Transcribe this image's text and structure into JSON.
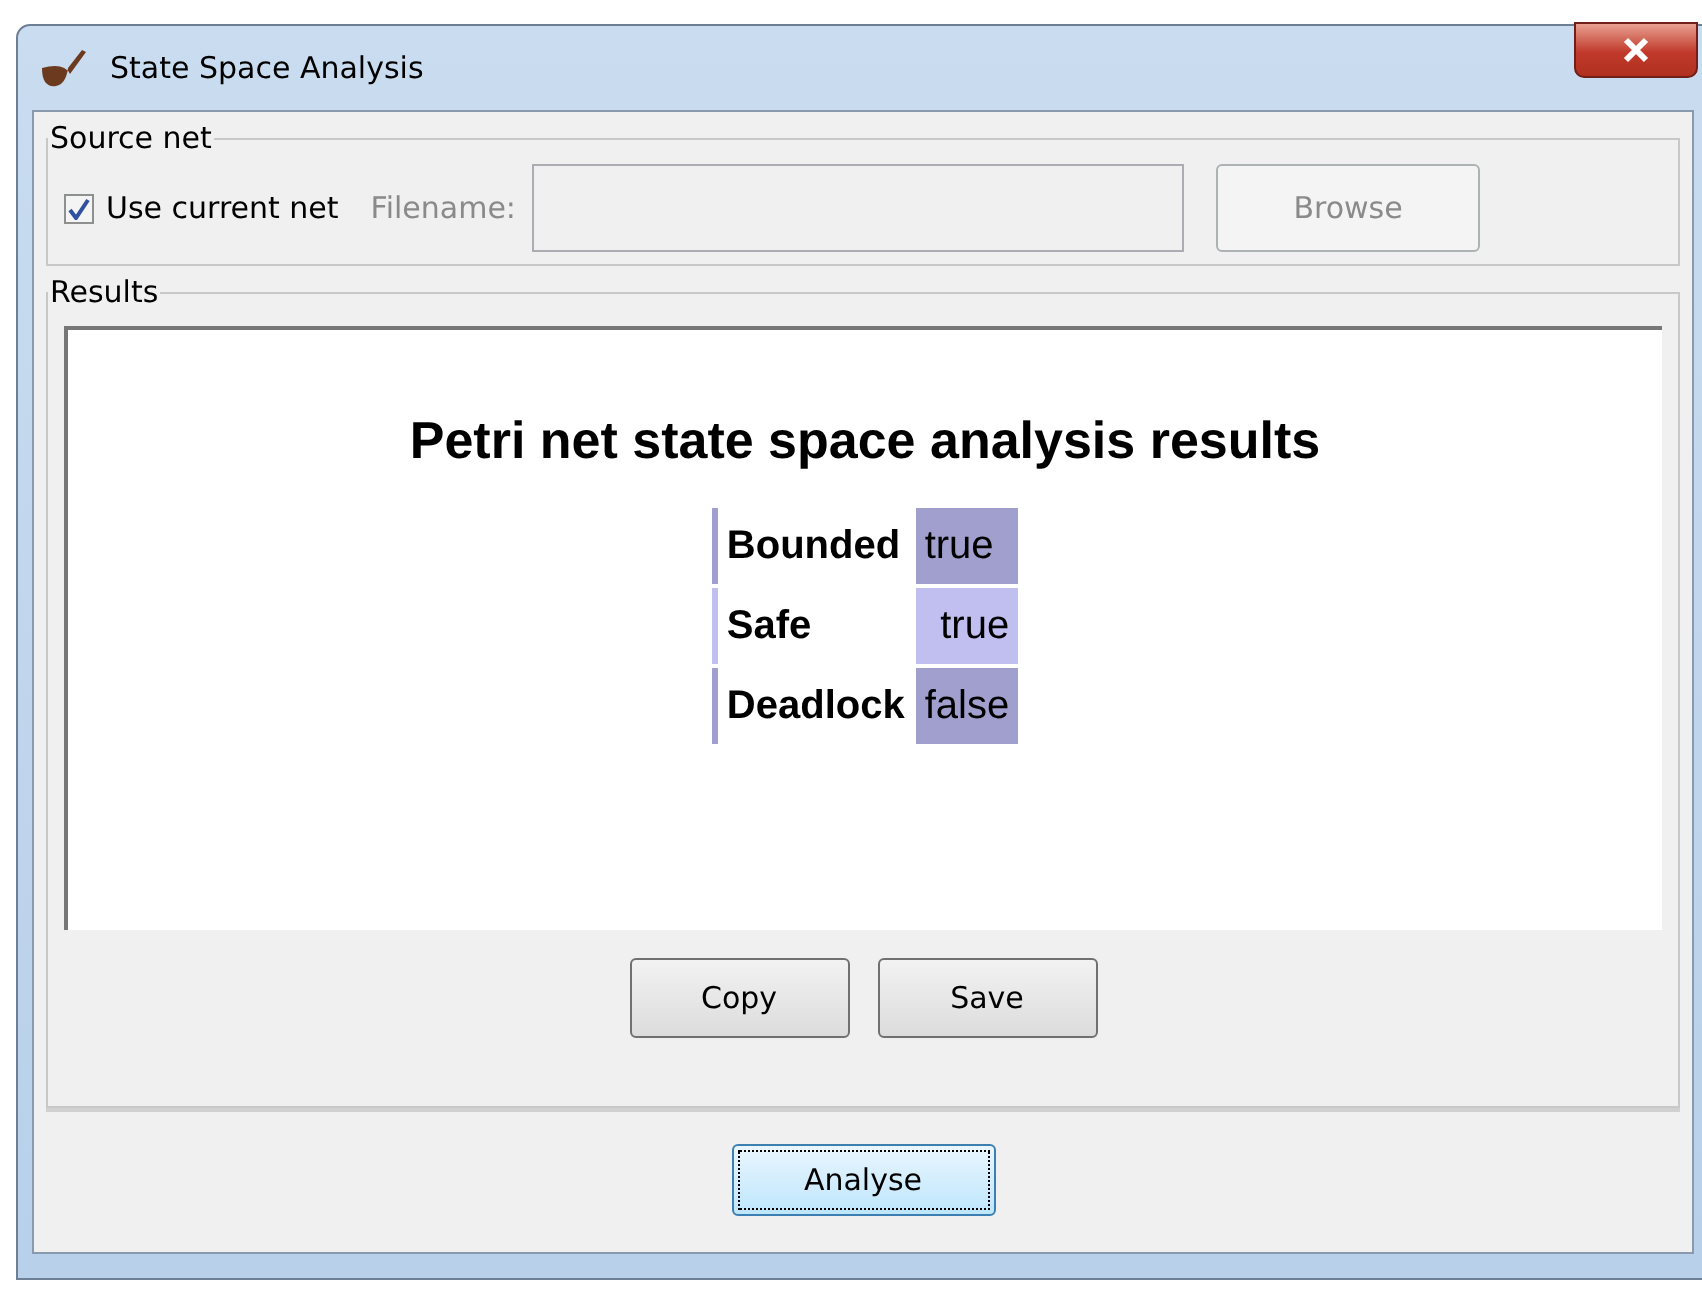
{
  "window": {
    "title": "State Space Analysis"
  },
  "source_net": {
    "legend": "Source net",
    "use_current": {
      "label": "Use current net",
      "checked": true
    },
    "filename": {
      "label": "Filename:",
      "disabled": true
    },
    "browse": {
      "label": "Browse",
      "disabled": true
    }
  },
  "results": {
    "legend": "Results",
    "heading": "Petri net state space analysis results",
    "rows": [
      {
        "name": "Bounded",
        "value": "true"
      },
      {
        "name": "Safe",
        "value": "true"
      },
      {
        "name": "Deadlock",
        "value": "false"
      }
    ],
    "buttons": [
      "Copy",
      "Save"
    ]
  },
  "analyse_button": "Analyse"
}
